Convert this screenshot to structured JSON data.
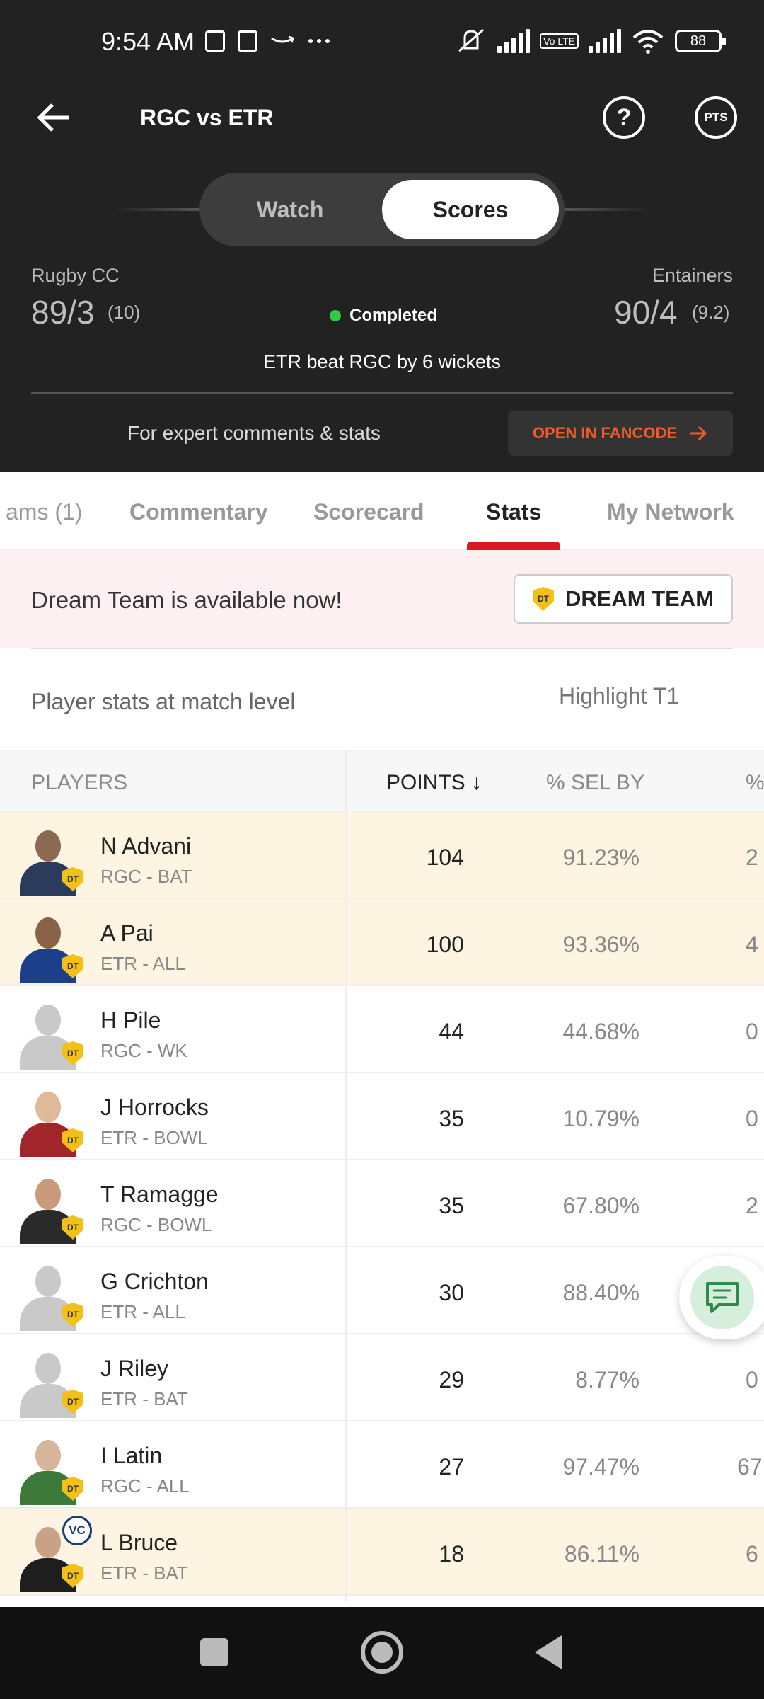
{
  "status_bar": {
    "time": "9:54 AM",
    "volte": "Vo LTE",
    "battery": "88",
    "icons": [
      "message-icon",
      "app-icon",
      "amazon-icon",
      "more-icon",
      "mute-icon",
      "signal-icon",
      "volte-icon",
      "signal-icon",
      "wifi-icon",
      "battery-icon"
    ]
  },
  "toolbar": {
    "title": "RGC vs ETR",
    "help_label": "?",
    "pts_label": "PTS"
  },
  "toggle": {
    "watch": "Watch",
    "scores": "Scores",
    "selected": "Scores"
  },
  "match": {
    "team_left": {
      "name": "Rugby CC",
      "score": "89/3",
      "overs": "(10)"
    },
    "team_right": {
      "name": "Entainers",
      "score": "90/4",
      "overs": "(9.2)"
    },
    "status": "Completed",
    "result": "ETR beat RGC by 6 wickets"
  },
  "fancode": {
    "text": "For expert comments & stats",
    "button": "OPEN IN FANCODE"
  },
  "tabs": [
    {
      "label": "ams (1)"
    },
    {
      "label": "Commentary"
    },
    {
      "label": "Scorecard"
    },
    {
      "label": "Stats"
    },
    {
      "label": "My Network"
    }
  ],
  "active_tab": "Stats",
  "dream_banner": {
    "text": "Dream Team is available now!",
    "button": "DREAM TEAM",
    "badge": "DT"
  },
  "subhead": {
    "left": "Player stats at match level",
    "right": "Highlight T1"
  },
  "table_headers": {
    "players": "PLAYERS",
    "points": "POINTS ↓",
    "sel_by": "% SEL BY",
    "extra": "%"
  },
  "players": [
    {
      "name": "N Advani",
      "team_role": "RGC - BAT",
      "points": "104",
      "sel": "91.23%",
      "extra": "2",
      "highlight": true,
      "dt": "DT"
    },
    {
      "name": "A Pai",
      "team_role": "ETR - ALL",
      "points": "100",
      "sel": "93.36%",
      "extra": "4",
      "highlight": true,
      "dt": "DT"
    },
    {
      "name": "H Pile",
      "team_role": "RGC - WK",
      "points": "44",
      "sel": "44.68%",
      "extra": "0",
      "highlight": false,
      "dt": "DT"
    },
    {
      "name": "J Horrocks",
      "team_role": "ETR - BOWL",
      "points": "35",
      "sel": "10.79%",
      "extra": "0",
      "highlight": false,
      "dt": "DT"
    },
    {
      "name": "T Ramagge",
      "team_role": "RGC - BOWL",
      "points": "35",
      "sel": "67.80%",
      "extra": "2",
      "highlight": false,
      "dt": "DT"
    },
    {
      "name": "G Crichton",
      "team_role": "ETR - ALL",
      "points": "30",
      "sel": "88.40%",
      "extra": "",
      "highlight": false,
      "dt": "DT"
    },
    {
      "name": "J Riley",
      "team_role": "ETR - BAT",
      "points": "29",
      "sel": "8.77%",
      "extra": "0",
      "highlight": false,
      "dt": "DT"
    },
    {
      "name": "I Latin",
      "team_role": "RGC - ALL",
      "points": "27",
      "sel": "97.47%",
      "extra": "67",
      "highlight": false,
      "dt": "DT"
    },
    {
      "name": "L Bruce",
      "team_role": "ETR - BAT",
      "points": "18",
      "sel": "86.11%",
      "extra": "6",
      "highlight": true,
      "dt": "DT",
      "vc": "VC"
    }
  ],
  "colors": {
    "header_bg": "#222222",
    "accent_red": "#d71a21",
    "fancode_orange": "#f05a28",
    "highlight_row": "#fdf5e1",
    "banner_bg": "#fdf0f2",
    "dt_gold": "#f2c117",
    "status_green": "#2ecc40"
  }
}
